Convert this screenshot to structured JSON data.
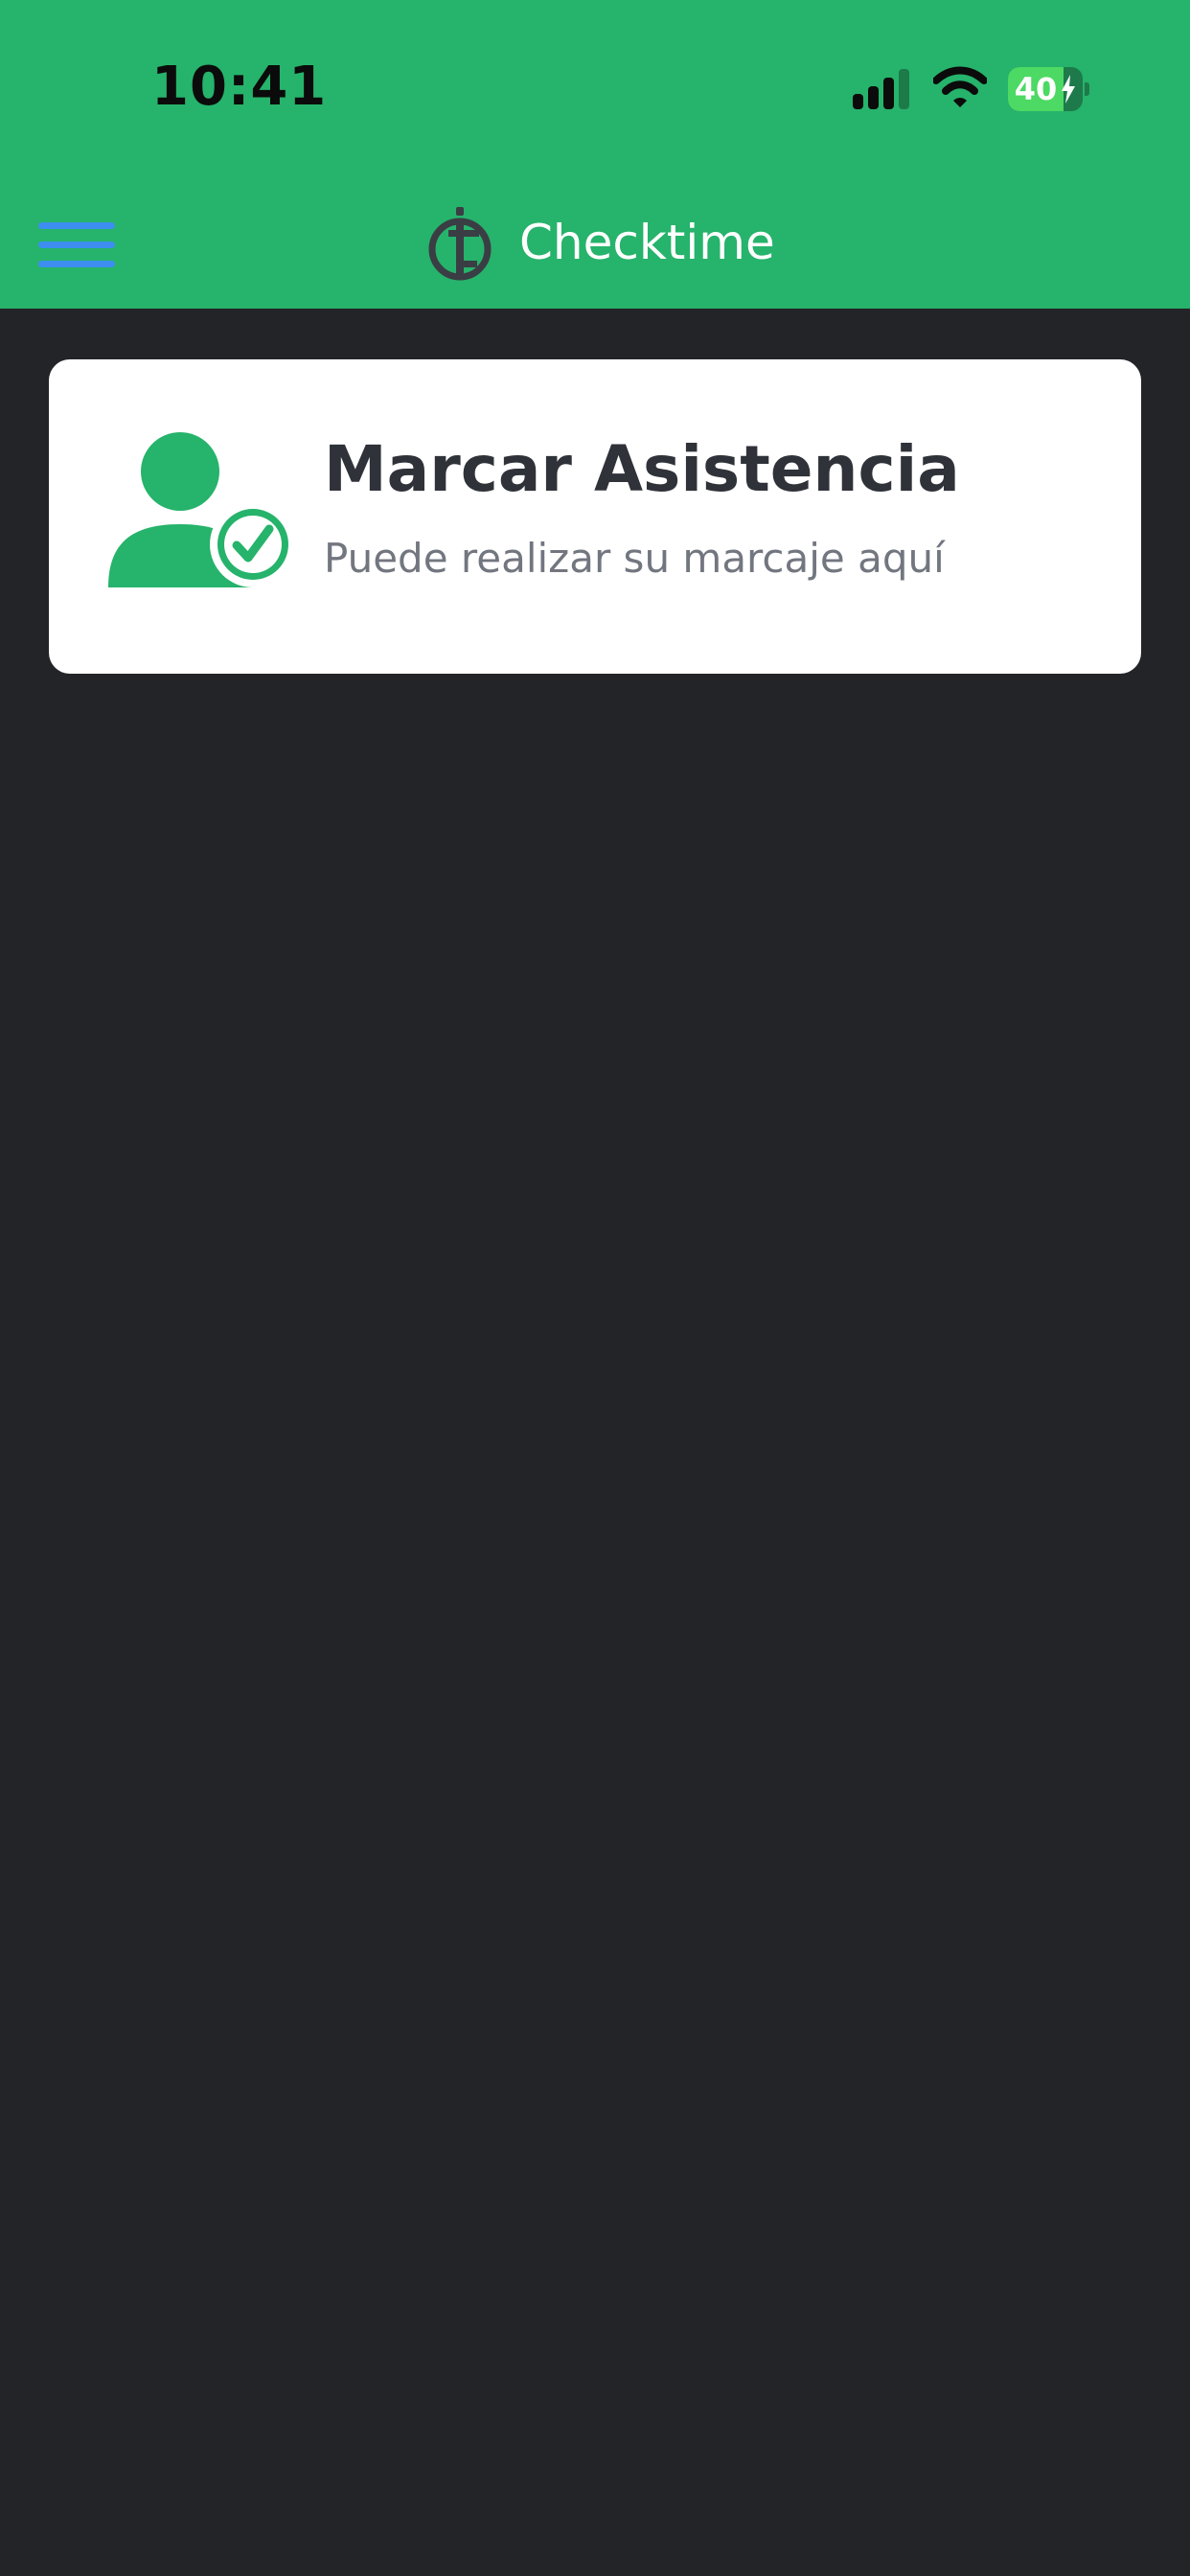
{
  "status_bar": {
    "time": "10:41",
    "battery_level": "40",
    "icons": [
      "signal-icon",
      "wifi-icon",
      "battery-icon"
    ]
  },
  "header": {
    "title": "Checktime",
    "menu_icon": "hamburger-menu-icon",
    "logo_icon": "checktime-logo-icon"
  },
  "card": {
    "title": "Marcar Asistencia",
    "subtitle": "Puede realizar su marcaje aquí",
    "icon": "user-check-icon"
  },
  "colors": {
    "header_bg": "#26B36B",
    "page_bg": "#232428",
    "card_bg": "#FFFFFF",
    "accent": "#26B36B",
    "menu_icon": "#3D8EF0",
    "title_text": "#2F3239",
    "subtitle_text": "#72767F"
  }
}
